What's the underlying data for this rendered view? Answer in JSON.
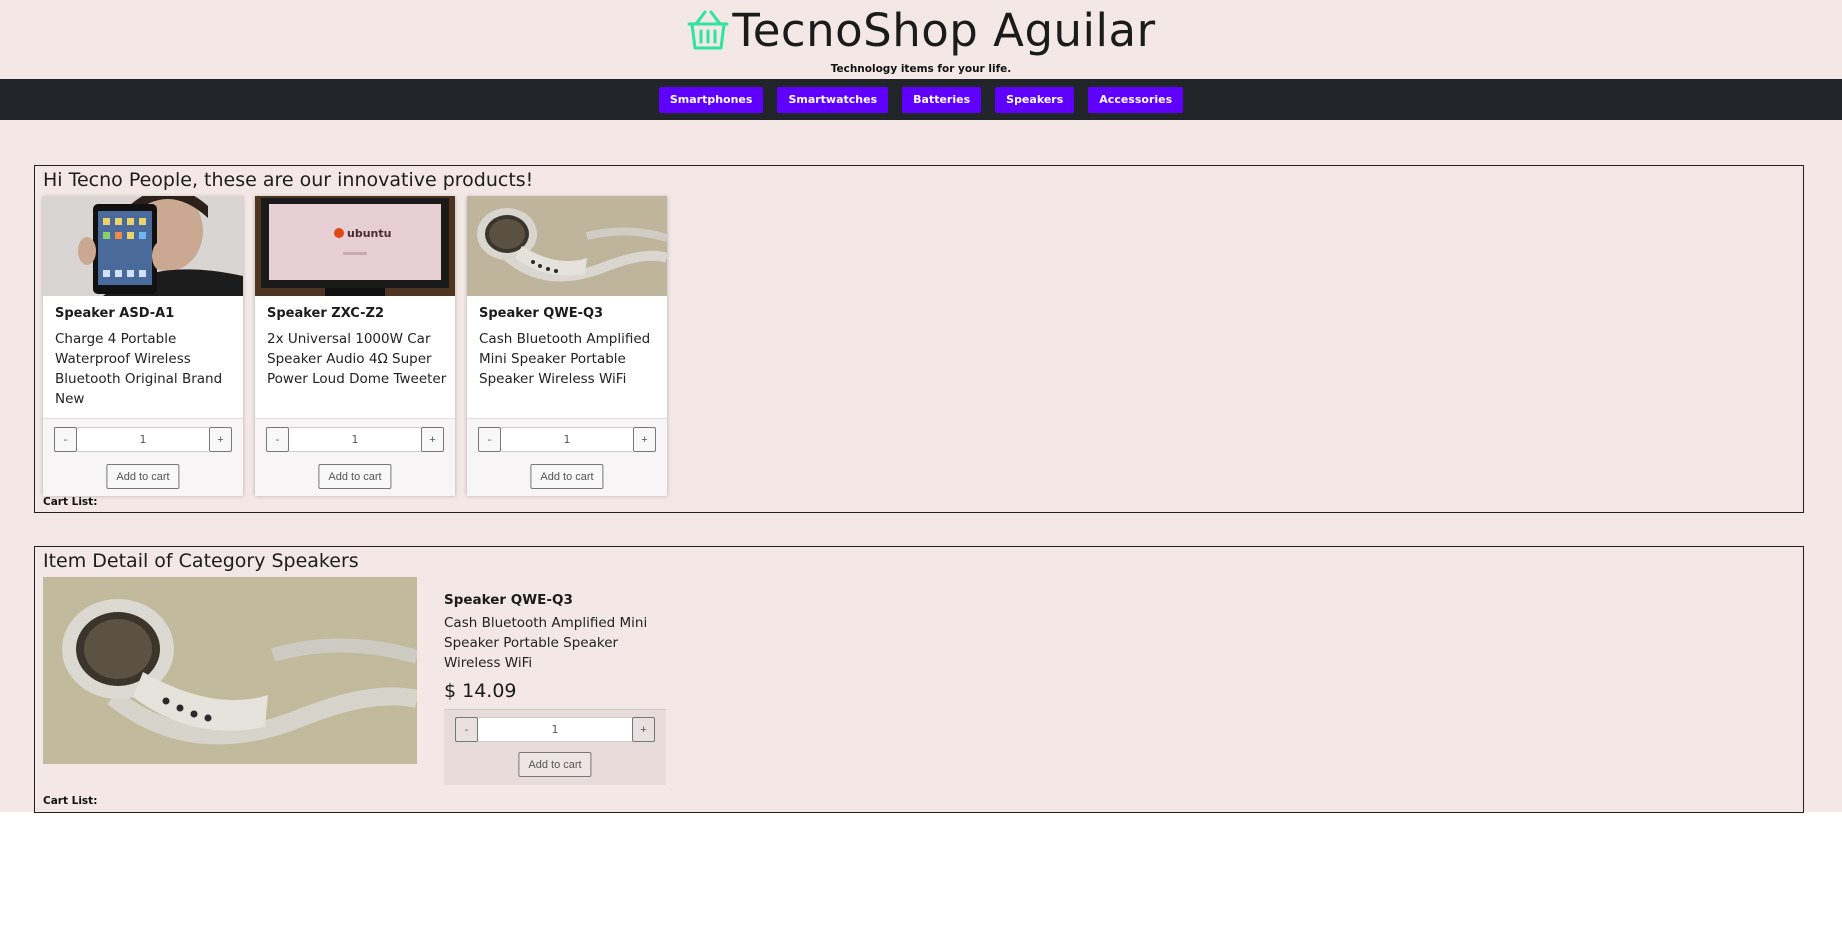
{
  "header": {
    "logo_icon": "basket-icon",
    "title": "TecnoShop Aguilar",
    "tagline": "Technology items for your life."
  },
  "nav": {
    "items": [
      "Smartphones",
      "Smartwatches",
      "Batteries",
      "Speakers",
      "Accessories"
    ]
  },
  "products_section": {
    "title": "Hi Tecno People, these are our innovative products!",
    "cart_label": "Cart List:",
    "cards": [
      {
        "name": "Speaker ASD-A1",
        "description": "Charge 4 Portable Waterproof Wireless Bluetooth Original Brand New",
        "image": "person-holding-tablet",
        "minus": "-",
        "quantity": "1",
        "plus": "+",
        "add_label": "Add to cart"
      },
      {
        "name": "Speaker ZXC-Z2",
        "description": "2x Universal 1000W Car Speaker Audio 4Ω Super Power Loud Dome Tweeter",
        "image": "monitor-ubuntu-screen",
        "minus": "-",
        "quantity": "1",
        "plus": "+",
        "add_label": "Add to cart"
      },
      {
        "name": "Speaker QWE-Q3",
        "description": "Cash Bluetooth Amplified Mini Speaker Portable Speaker Wireless WiFi",
        "image": "white-earbuds",
        "minus": "-",
        "quantity": "1",
        "plus": "+",
        "add_label": "Add to cart"
      }
    ]
  },
  "detail_section": {
    "title": "Item Detail of Category Speakers",
    "image": "white-earbuds",
    "name": "Speaker QWE-Q3",
    "description": "Cash Bluetooth Amplified Mini Speaker Portable Speaker Wireless WiFi",
    "price": "$ 14.09",
    "minus": "-",
    "quantity": "1",
    "plus": "+",
    "add_label": "Add to cart",
    "cart_label": "Cart List:"
  },
  "colors": {
    "page_bg": "#f3e8e6",
    "nav_bg": "#212529",
    "nav_button": "#5f00ff",
    "logo_green": "#2ee59d"
  }
}
